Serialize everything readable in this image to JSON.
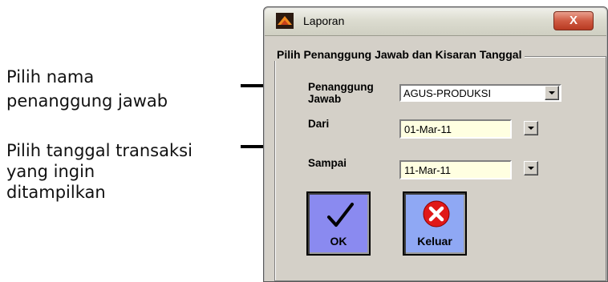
{
  "annotations": {
    "responsible_line1": "Pilih nama",
    "responsible_line2": "penanggung jawab",
    "date_line1": "Pilih tanggal transaksi",
    "date_line2": "yang ingin",
    "date_line3": "ditampilkan"
  },
  "window": {
    "title": "Laporan",
    "close_label": "X",
    "icon": "app-icon"
  },
  "group": {
    "title": "Pilih Penanggung Jawab dan Kisaran Tanggal"
  },
  "form": {
    "penanggung_label_1": "Penanggung",
    "penanggung_label_2": "Jawab",
    "penanggung_value": "AGUS-PRODUKSI",
    "dari_label": "Dari",
    "dari_value": "01-Mar-11",
    "sampai_label": "Sampai",
    "sampai_value": "11-Mar-11"
  },
  "buttons": {
    "ok_label": "OK",
    "keluar_label": "Keluar",
    "ok_icon": "checkmark-icon",
    "keluar_icon": "close-circle-icon",
    "ok_bg": "#8a8af0",
    "keluar_bg": "#8fa8f4",
    "keluar_icon_color": "#e01818"
  },
  "colors": {
    "dialog_bg": "#d4d0c8",
    "date_bg": "#ffffe1",
    "close_button": "#cf5a42"
  }
}
